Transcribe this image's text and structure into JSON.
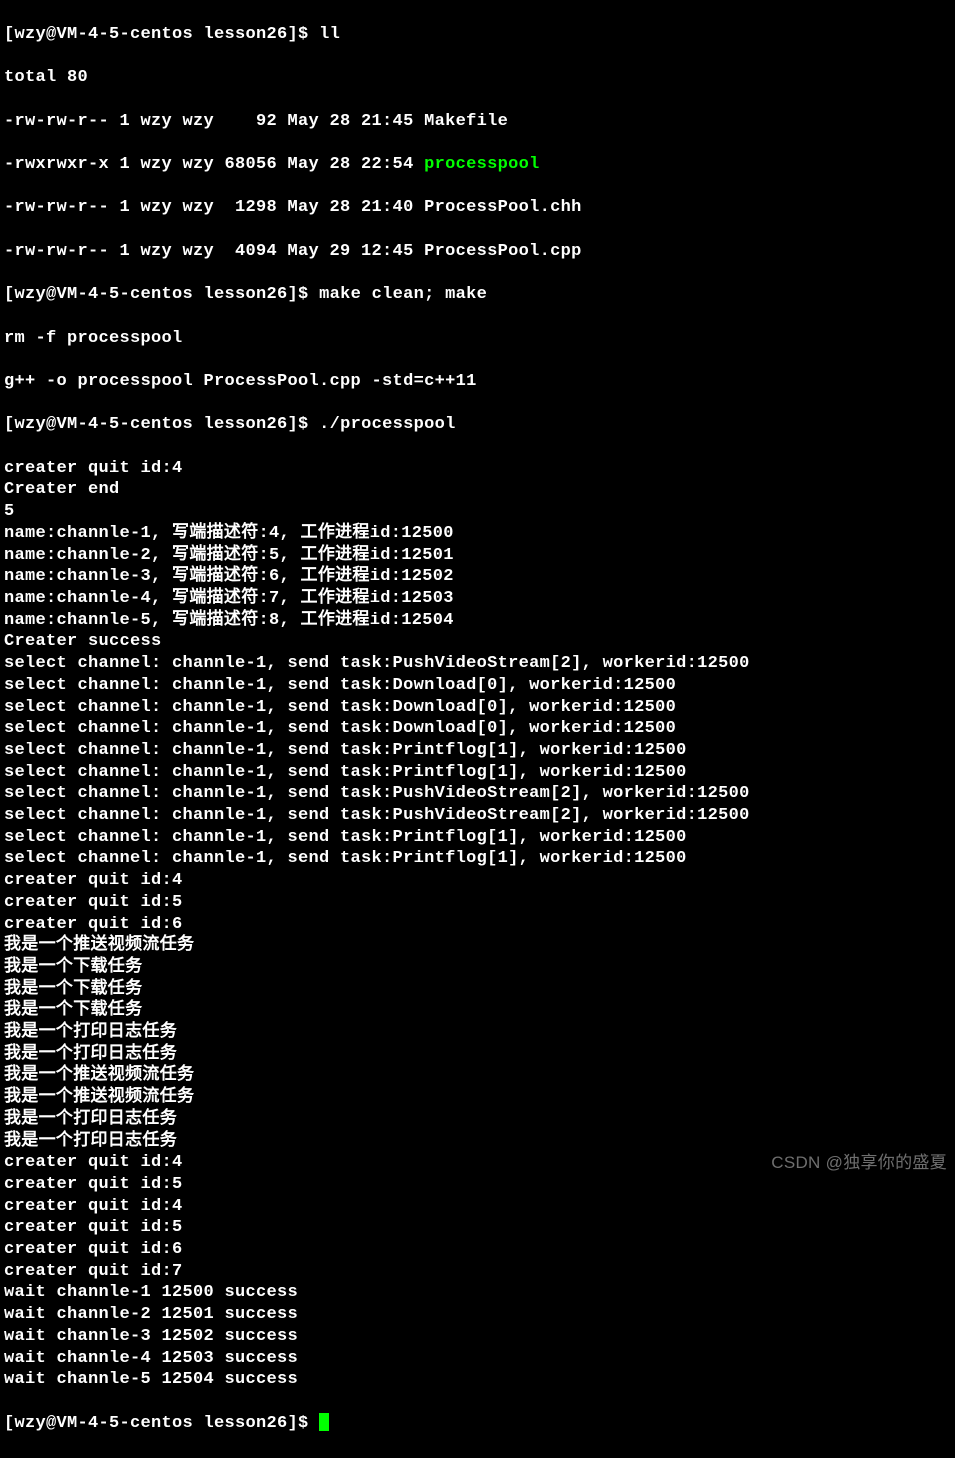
{
  "prompt1": "[wzy@VM-4-5-centos lesson26]$ ",
  "cmd_ll": "ll",
  "ls_output": {
    "total": "total 80",
    "rows": [
      "-rw-rw-r-- 1 wzy wzy    92 May 28 21:45 Makefile",
      "-rwxrwxr-x 1 wzy wzy 68056 May 28 22:54 ",
      "-rw-rw-r-- 1 wzy wzy  1298 May 28 21:40 ProcessPool.chh",
      "-rw-rw-r-- 1 wzy wzy  4094 May 29 12:45 ProcessPool.cpp"
    ],
    "exec_name": "processpool"
  },
  "cmd_make": "make clean; make",
  "make_output": [
    "rm -f processpool",
    "g++ -o processpool ProcessPool.cpp -std=c++11"
  ],
  "cmd_run": "./processpool",
  "run_output": [
    "creater quit id:4",
    "Creater end",
    "5",
    "name:channle-1, 写端描述符:4, 工作进程id:12500",
    "name:channle-2, 写端描述符:5, 工作进程id:12501",
    "name:channle-3, 写端描述符:6, 工作进程id:12502",
    "name:channle-4, 写端描述符:7, 工作进程id:12503",
    "name:channle-5, 写端描述符:8, 工作进程id:12504",
    "Creater success",
    "select channel: channle-1, send task:PushVideoStream[2], workerid:12500",
    "select channel: channle-1, send task:Download[0], workerid:12500",
    "select channel: channle-1, send task:Download[0], workerid:12500",
    "select channel: channle-1, send task:Download[0], workerid:12500",
    "select channel: channle-1, send task:Printflog[1], workerid:12500",
    "select channel: channle-1, send task:Printflog[1], workerid:12500",
    "select channel: channle-1, send task:PushVideoStream[2], workerid:12500",
    "select channel: channle-1, send task:PushVideoStream[2], workerid:12500",
    "select channel: channle-1, send task:Printflog[1], workerid:12500",
    "select channel: channle-1, send task:Printflog[1], workerid:12500",
    "creater quit id:4",
    "creater quit id:5",
    "creater quit id:6",
    "我是一个推送视频流任务",
    "我是一个下载任务",
    "我是一个下载任务",
    "我是一个下载任务",
    "我是一个打印日志任务",
    "我是一个打印日志任务",
    "我是一个推送视频流任务",
    "我是一个推送视频流任务",
    "我是一个打印日志任务",
    "我是一个打印日志任务",
    "creater quit id:4",
    "creater quit id:5",
    "creater quit id:4",
    "creater quit id:5",
    "creater quit id:6",
    "creater quit id:7",
    "wait channle-1 12500 success",
    "wait channle-2 12501 success",
    "wait channle-3 12502 success",
    "wait channle-4 12503 success",
    "wait channle-5 12504 success"
  ],
  "watermark": "CSDN @独享你的盛夏"
}
